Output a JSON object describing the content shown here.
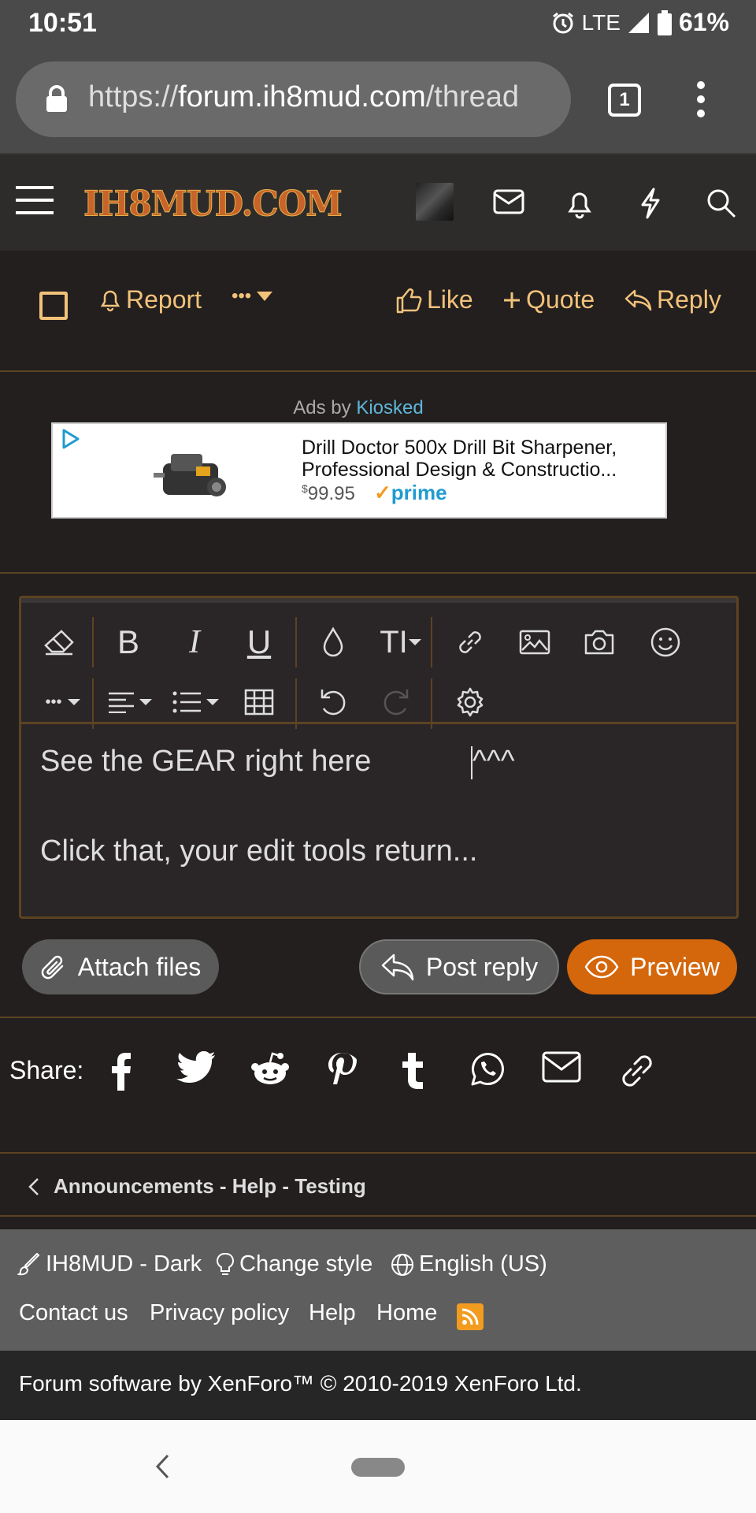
{
  "status_bar": {
    "time": "10:51",
    "network": "LTE",
    "battery": "61%"
  },
  "browser": {
    "url_scheme": "https://",
    "url_host": "forum.ih8mud.com",
    "url_path": "/thread",
    "tab_count": "1"
  },
  "site": {
    "logo_text": "IH8MUD.COM"
  },
  "actions": {
    "report": "Report",
    "more": "•••",
    "like": "Like",
    "quote": "Quote",
    "reply": "Reply"
  },
  "ad": {
    "ads_by_prefix": "Ads by ",
    "ads_by_brand": "Kiosked",
    "title": "Drill Doctor 500x Drill Bit Sharpener, Professional Design & Constructio...",
    "price_currency": "$",
    "price": "99.95",
    "badge": "prime"
  },
  "editor": {
    "toolbar_row1": [
      "eraser-icon",
      "bold-icon",
      "italic-icon",
      "underline-icon",
      "color-icon",
      "text-size-icon",
      "link-icon",
      "image-icon",
      "camera-icon",
      "smiley-icon"
    ],
    "toolbar_row2": [
      "more-icon",
      "align-icon",
      "list-icon",
      "table-icon",
      "undo-icon",
      "redo-icon",
      "gear-icon"
    ],
    "line1": "See the GEAR right here            ",
    "line1_tail": "^^^",
    "line2": "Click that, your edit tools return..."
  },
  "buttons": {
    "attach": "Attach files",
    "post_reply": "Post reply",
    "preview": "Preview"
  },
  "share": {
    "label": "Share:",
    "icons": [
      "facebook-icon",
      "twitter-icon",
      "reddit-icon",
      "pinterest-icon",
      "tumblr-icon",
      "whatsapp-icon",
      "email-icon",
      "link-icon"
    ]
  },
  "breadcrumb": {
    "text": "Announcements - Help - Testing"
  },
  "footer": {
    "style_name": "IH8MUD - Dark",
    "change_style": "Change style",
    "language": "English (US)",
    "links": [
      "Contact us",
      "Privacy policy",
      "Help",
      "Home"
    ],
    "copyright": "Forum software by XenForo™ © 2010-2019 XenForo Ltd."
  },
  "colors": {
    "accent": "#f2c27b",
    "preview_button": "#d4660b",
    "border": "#5c4322"
  }
}
